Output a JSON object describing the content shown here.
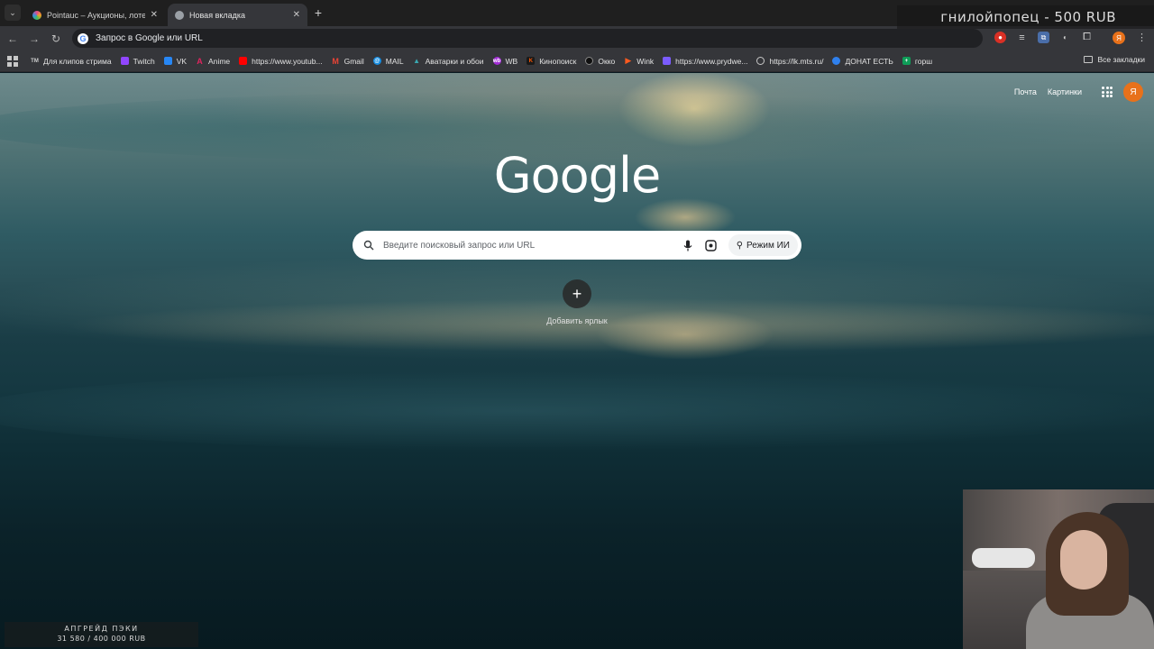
{
  "browser": {
    "tabs": [
      {
        "title": "Pointauc – Аукционы, лотереи",
        "active": false,
        "favicon_color": "#e34b8a"
      },
      {
        "title": "Новая вкладка",
        "active": true,
        "favicon_color": "#9aa0a6"
      }
    ],
    "address_bar": {
      "text": "Запрос в Google или URL"
    },
    "bookmarks": [
      {
        "label": "Для клипов стрима",
        "icon": "tm-icon",
        "color": "#555555"
      },
      {
        "label": "Twitch",
        "icon": "twitch-icon",
        "color": "#9146ff"
      },
      {
        "label": "VK",
        "icon": "vk-icon",
        "color": "#2787f5"
      },
      {
        "label": "Anime",
        "icon": "anime-icon",
        "color": "#e0245e"
      },
      {
        "label": "https://www.youtub...",
        "icon": "youtube-icon",
        "color": "#ff0000"
      },
      {
        "label": "Gmail",
        "icon": "gmail-icon",
        "color": "#ea4335"
      },
      {
        "label": "MAIL",
        "icon": "mail-icon",
        "color": "#168de2"
      },
      {
        "label": "Аватарки и обои",
        "icon": "avatars-icon",
        "color": "#3aa7b0"
      },
      {
        "label": "WB",
        "icon": "wb-icon",
        "color": "#a22bd6"
      },
      {
        "label": "Кинопоиск",
        "icon": "kinopoisk-icon",
        "color": "#ff5500"
      },
      {
        "label": "Окко",
        "icon": "okko-icon",
        "color": "#202020"
      },
      {
        "label": "Wink",
        "icon": "wink-icon",
        "color": "#ff5a1f"
      },
      {
        "label": "https://www.prydwe...",
        "icon": "prydwen-icon",
        "color": "#7b5cff"
      },
      {
        "label": "https://lk.mts.ru/",
        "icon": "globe-icon",
        "color": "#9aa0a6"
      },
      {
        "label": "ДОНАТ ЕСТЬ",
        "icon": "donat-icon",
        "color": "#2f80ed"
      },
      {
        "label": "горш",
        "icon": "sheets-icon",
        "color": "#0f9d58"
      }
    ],
    "all_bookmarks": "Все закладки",
    "profile_letter": "Я"
  },
  "newtab": {
    "links": [
      "Почта",
      "Картинки"
    ],
    "avatar_letter": "Я",
    "logo": "Google",
    "search_placeholder": "Введите поисковый запрос или URL",
    "ai_mode_label": "Режим ИИ",
    "add_shortcut_label": "Добавить ярлык"
  },
  "stream_overlay": {
    "donation": "гнилойпопец - 500 RUB",
    "goal_title": "АПГРЕЙД ПЭКИ",
    "goal_progress": "31 580 / 400 000 RUB"
  },
  "colors": {
    "accent_orange": "#e8711a",
    "toolbar": "#35363a",
    "tabstrip": "#1f1f1f"
  }
}
